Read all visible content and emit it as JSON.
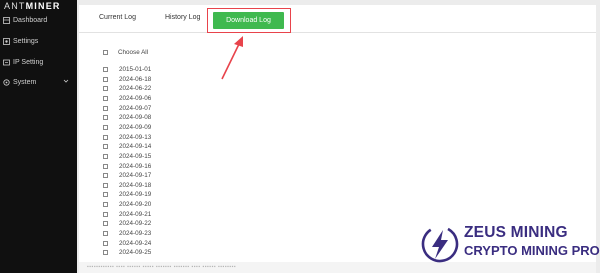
{
  "brand": {
    "prefix": "ANT",
    "suffix": "MINER"
  },
  "sidebar": {
    "items": [
      {
        "label": "Dashboard",
        "icon": "dashboard-icon"
      },
      {
        "label": "Settings",
        "icon": "settings-icon"
      },
      {
        "label": "IP Setting",
        "icon": "ip-setting-icon"
      },
      {
        "label": "System",
        "icon": "system-icon"
      }
    ]
  },
  "tabs": {
    "current": "Current Log",
    "history": "History Log",
    "download": "Download Log"
  },
  "log_list": {
    "choose_all": "Choose All",
    "dates": [
      "2015-01-01",
      "2024-06-18",
      "2024-06-22",
      "2024-09-06",
      "2024-09-07",
      "2024-09-08",
      "2024-09-09",
      "2024-09-13",
      "2024-09-14",
      "2024-09-15",
      "2024-09-16",
      "2024-09-17",
      "2024-09-18",
      "2024-09-19",
      "2024-09-20",
      "2024-09-21",
      "2024-09-22",
      "2024-09-23",
      "2024-09-24",
      "2024-09-25"
    ]
  },
  "watermark": {
    "line1": "ZEUS MINING",
    "line2": "CRYPTO MINING PRO"
  },
  "colors": {
    "sidebar_bg": "#101010",
    "download_button": "#3fb94f",
    "highlight": "#e8434b",
    "watermark": "#3a2d80"
  }
}
